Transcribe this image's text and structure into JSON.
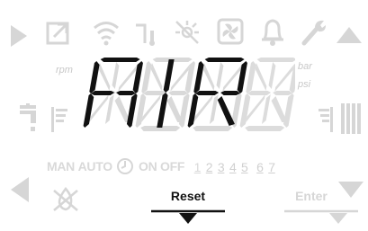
{
  "display": {
    "text_chars": [
      "A",
      "I",
      "R",
      "8"
    ],
    "units": {
      "rpm": "rpm",
      "bar": "bar",
      "psi": "psi"
    }
  },
  "mode_row": {
    "man": "MAN",
    "auto": "AUTO",
    "on": "ON",
    "off": "OFF",
    "days": [
      "1",
      "2",
      "3",
      "4",
      "5",
      "6",
      "7"
    ]
  },
  "buttons": {
    "reset_label": "Reset",
    "enter_label": "Enter"
  },
  "icons": {
    "top_row": [
      "play-right-icon",
      "external-link-icon",
      "wifi-icon",
      "tap-thermometer-icon",
      "sun-off-icon",
      "fan-icon",
      "bell-icon",
      "wrench-icon",
      "arrow-up-icon"
    ],
    "middle_left": [
      "tap-icon",
      "flow-level-icon"
    ],
    "middle_right": [
      "radiator-level-icon",
      "radiator-icon"
    ],
    "bottom": [
      "arrow-left-icon",
      "flame-off-icon",
      "arrow-down-icon"
    ]
  },
  "colors": {
    "active": "#111111",
    "ghost": "#d6d6d6",
    "label_ghost": "#c8c8c8"
  }
}
